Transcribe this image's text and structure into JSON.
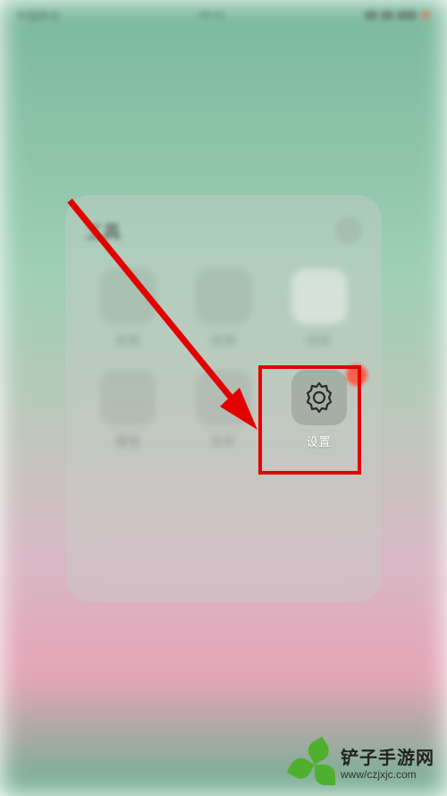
{
  "status": {
    "left": "中国移动",
    "center": "09:41"
  },
  "folder": {
    "title": "工具"
  },
  "apps": {
    "a1": {
      "label": "应用"
    },
    "a2": {
      "label": "应用"
    },
    "a3": {
      "label": "日历"
    },
    "a4": {
      "label": "便签"
    },
    "a5": {
      "label": "文件"
    },
    "settings": {
      "label": "设置"
    }
  },
  "icons": {
    "settings": "gear-icon"
  },
  "colors": {
    "highlight": "#e20000",
    "arrow": "#e20000",
    "brand": "#4fb030"
  },
  "watermark": {
    "name": "铲子手游网",
    "url": "www/czjxjc.com"
  }
}
